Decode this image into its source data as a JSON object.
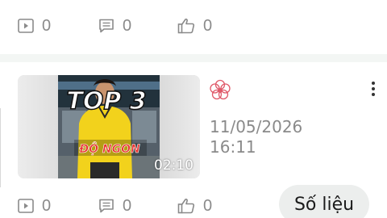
{
  "top_stats": {
    "views": "0",
    "comments": "0",
    "likes": "0"
  },
  "video": {
    "duration": "02:10",
    "thumbnail_text_top": "TOP 3",
    "thumbnail_text_bottom": "ĐỘ NGON",
    "date": "11/05/2026",
    "time": "16:11"
  },
  "bottom_stats": {
    "views": "0",
    "comments": "0",
    "likes": "0"
  },
  "actions": {
    "stats_button": "Số liệu"
  },
  "colors": {
    "muted_text": "#8a8a8a",
    "logo": "#e05a6a",
    "button_bg": "#eceeed"
  }
}
